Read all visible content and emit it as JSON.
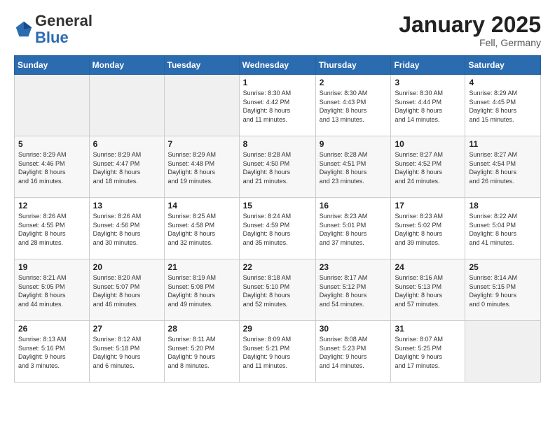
{
  "header": {
    "logo_line1": "General",
    "logo_line2": "Blue",
    "month_title": "January 2025",
    "location": "Fell, Germany"
  },
  "weekdays": [
    "Sunday",
    "Monday",
    "Tuesday",
    "Wednesday",
    "Thursday",
    "Friday",
    "Saturday"
  ],
  "weeks": [
    [
      {
        "day": "",
        "info": ""
      },
      {
        "day": "",
        "info": ""
      },
      {
        "day": "",
        "info": ""
      },
      {
        "day": "1",
        "info": "Sunrise: 8:30 AM\nSunset: 4:42 PM\nDaylight: 8 hours\nand 11 minutes."
      },
      {
        "day": "2",
        "info": "Sunrise: 8:30 AM\nSunset: 4:43 PM\nDaylight: 8 hours\nand 13 minutes."
      },
      {
        "day": "3",
        "info": "Sunrise: 8:30 AM\nSunset: 4:44 PM\nDaylight: 8 hours\nand 14 minutes."
      },
      {
        "day": "4",
        "info": "Sunrise: 8:29 AM\nSunset: 4:45 PM\nDaylight: 8 hours\nand 15 minutes."
      }
    ],
    [
      {
        "day": "5",
        "info": "Sunrise: 8:29 AM\nSunset: 4:46 PM\nDaylight: 8 hours\nand 16 minutes."
      },
      {
        "day": "6",
        "info": "Sunrise: 8:29 AM\nSunset: 4:47 PM\nDaylight: 8 hours\nand 18 minutes."
      },
      {
        "day": "7",
        "info": "Sunrise: 8:29 AM\nSunset: 4:48 PM\nDaylight: 8 hours\nand 19 minutes."
      },
      {
        "day": "8",
        "info": "Sunrise: 8:28 AM\nSunset: 4:50 PM\nDaylight: 8 hours\nand 21 minutes."
      },
      {
        "day": "9",
        "info": "Sunrise: 8:28 AM\nSunset: 4:51 PM\nDaylight: 8 hours\nand 23 minutes."
      },
      {
        "day": "10",
        "info": "Sunrise: 8:27 AM\nSunset: 4:52 PM\nDaylight: 8 hours\nand 24 minutes."
      },
      {
        "day": "11",
        "info": "Sunrise: 8:27 AM\nSunset: 4:54 PM\nDaylight: 8 hours\nand 26 minutes."
      }
    ],
    [
      {
        "day": "12",
        "info": "Sunrise: 8:26 AM\nSunset: 4:55 PM\nDaylight: 8 hours\nand 28 minutes."
      },
      {
        "day": "13",
        "info": "Sunrise: 8:26 AM\nSunset: 4:56 PM\nDaylight: 8 hours\nand 30 minutes."
      },
      {
        "day": "14",
        "info": "Sunrise: 8:25 AM\nSunset: 4:58 PM\nDaylight: 8 hours\nand 32 minutes."
      },
      {
        "day": "15",
        "info": "Sunrise: 8:24 AM\nSunset: 4:59 PM\nDaylight: 8 hours\nand 35 minutes."
      },
      {
        "day": "16",
        "info": "Sunrise: 8:23 AM\nSunset: 5:01 PM\nDaylight: 8 hours\nand 37 minutes."
      },
      {
        "day": "17",
        "info": "Sunrise: 8:23 AM\nSunset: 5:02 PM\nDaylight: 8 hours\nand 39 minutes."
      },
      {
        "day": "18",
        "info": "Sunrise: 8:22 AM\nSunset: 5:04 PM\nDaylight: 8 hours\nand 41 minutes."
      }
    ],
    [
      {
        "day": "19",
        "info": "Sunrise: 8:21 AM\nSunset: 5:05 PM\nDaylight: 8 hours\nand 44 minutes."
      },
      {
        "day": "20",
        "info": "Sunrise: 8:20 AM\nSunset: 5:07 PM\nDaylight: 8 hours\nand 46 minutes."
      },
      {
        "day": "21",
        "info": "Sunrise: 8:19 AM\nSunset: 5:08 PM\nDaylight: 8 hours\nand 49 minutes."
      },
      {
        "day": "22",
        "info": "Sunrise: 8:18 AM\nSunset: 5:10 PM\nDaylight: 8 hours\nand 52 minutes."
      },
      {
        "day": "23",
        "info": "Sunrise: 8:17 AM\nSunset: 5:12 PM\nDaylight: 8 hours\nand 54 minutes."
      },
      {
        "day": "24",
        "info": "Sunrise: 8:16 AM\nSunset: 5:13 PM\nDaylight: 8 hours\nand 57 minutes."
      },
      {
        "day": "25",
        "info": "Sunrise: 8:14 AM\nSunset: 5:15 PM\nDaylight: 9 hours\nand 0 minutes."
      }
    ],
    [
      {
        "day": "26",
        "info": "Sunrise: 8:13 AM\nSunset: 5:16 PM\nDaylight: 9 hours\nand 3 minutes."
      },
      {
        "day": "27",
        "info": "Sunrise: 8:12 AM\nSunset: 5:18 PM\nDaylight: 9 hours\nand 6 minutes."
      },
      {
        "day": "28",
        "info": "Sunrise: 8:11 AM\nSunset: 5:20 PM\nDaylight: 9 hours\nand 8 minutes."
      },
      {
        "day": "29",
        "info": "Sunrise: 8:09 AM\nSunset: 5:21 PM\nDaylight: 9 hours\nand 11 minutes."
      },
      {
        "day": "30",
        "info": "Sunrise: 8:08 AM\nSunset: 5:23 PM\nDaylight: 9 hours\nand 14 minutes."
      },
      {
        "day": "31",
        "info": "Sunrise: 8:07 AM\nSunset: 5:25 PM\nDaylight: 9 hours\nand 17 minutes."
      },
      {
        "day": "",
        "info": ""
      }
    ]
  ]
}
